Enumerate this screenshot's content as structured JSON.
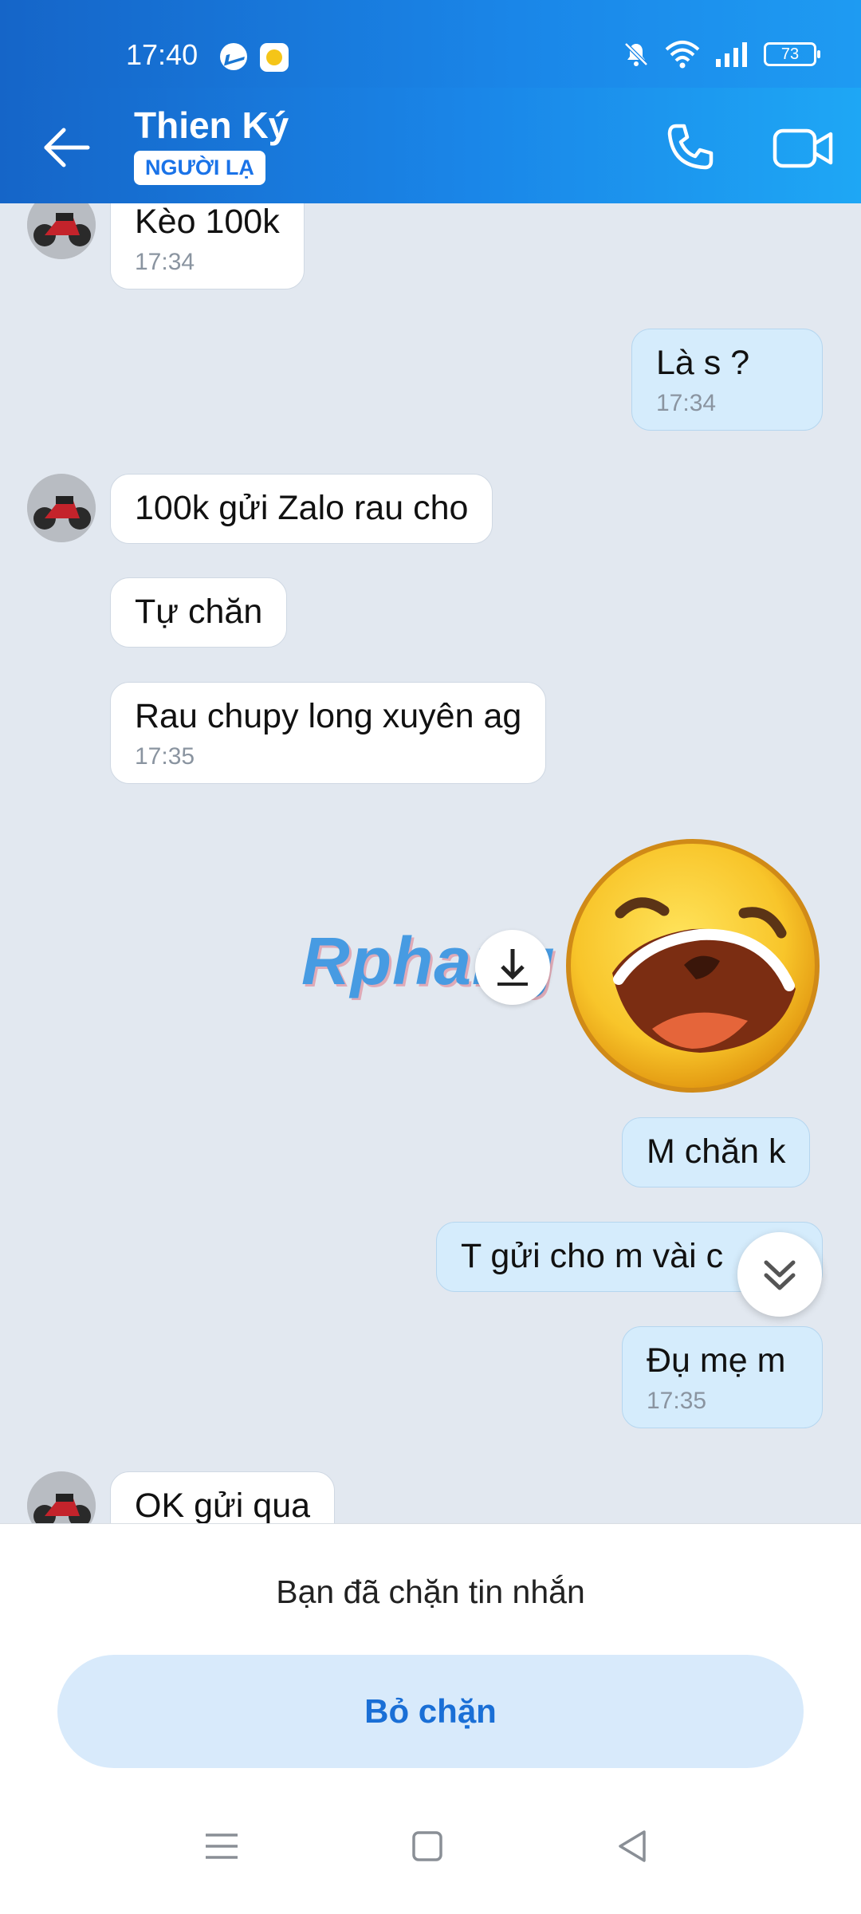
{
  "status_bar": {
    "time": "17:40",
    "battery": "73",
    "icons": [
      "messenger-icon",
      "app-notification-icon",
      "mute-icon",
      "wifi-icon",
      "signal-icon",
      "battery-icon"
    ]
  },
  "header": {
    "title": "Thien Ký",
    "badge": "NGƯỜI LẠ"
  },
  "messages": [
    {
      "side": "in",
      "text": "Kèo 100k",
      "time": "17:34"
    },
    {
      "side": "out",
      "text": "Là s ?",
      "time": "17:34"
    },
    {
      "side": "in",
      "text": "100k gửi Zalo rau cho",
      "time": ""
    },
    {
      "side": "in",
      "text": "Tự chăn",
      "time": ""
    },
    {
      "side": "in",
      "text": "Rau chupy long xuyên ag",
      "time": "17:35"
    },
    {
      "side": "out",
      "type": "sticker",
      "sticker": "laughing-emoji"
    },
    {
      "side": "out",
      "text": "M chăn k",
      "time": ""
    },
    {
      "side": "out",
      "text": "T gửi cho m vài c",
      "time": ""
    },
    {
      "side": "out",
      "text": "Đụ mẹ m",
      "time": "17:35"
    },
    {
      "side": "in",
      "text": "OK gửi qua",
      "time": ""
    }
  ],
  "watermark": "Rphang",
  "bottom": {
    "blocked_notice": "Bạn đã chặn tin nhắn",
    "unblock_label": "Bỏ chặn"
  },
  "colors": {
    "header_start": "#1565c8",
    "header_end": "#1ea7f5",
    "chat_bg": "#e2e8f0",
    "outgoing_bubble": "#d5ecfc",
    "incoming_bubble": "#ffffff",
    "unblock_text": "#1a6fd6"
  }
}
